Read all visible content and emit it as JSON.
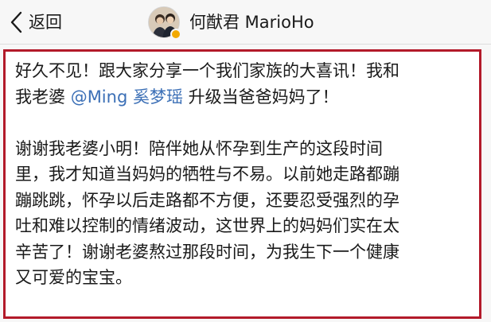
{
  "header": {
    "back_label": "返回",
    "back_icon": "chevron-left-icon",
    "profile_name": "何猷君 MarioHo",
    "verified_badge_color": "#f2a900"
  },
  "post": {
    "border_color": "#b31a2a",
    "mention_color": "#3b6fb6",
    "paragraph1": {
      "line1": "好久不见！跟大家分享一个我们家族的大喜讯！我和",
      "line2_before": "我老婆 ",
      "mention": "@Ming 奚梦瑶",
      "line2_after": " 升级当爸爸妈妈了！"
    },
    "paragraph2": [
      "谢谢我老婆小明！陪伴她从怀孕到生产的这段时间",
      "里，我才知道当妈妈的牺牲与不易。以前她走路都蹦",
      "蹦跳跳，怀孕以后走路都不方便，还要忍受强烈的孕",
      "吐和难以控制的情绪波动，这世界上的妈妈们实在太",
      "辛苦了！谢谢老婆熬过那段时间，为我生下一个健康",
      "又可爱的宝宝。"
    ]
  }
}
